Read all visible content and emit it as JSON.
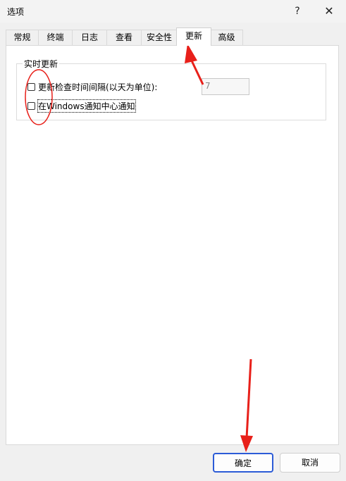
{
  "window": {
    "title": "选项",
    "help_glyph": "?",
    "close_glyph": "✕"
  },
  "tabs": [
    {
      "label": "常规"
    },
    {
      "label": "终端"
    },
    {
      "label": "日志"
    },
    {
      "label": "查看"
    },
    {
      "label": "安全性"
    },
    {
      "label": "更新",
      "active": true
    },
    {
      "label": "高级"
    }
  ],
  "group": {
    "title": "实时更新",
    "check_interval": {
      "label": "更新检查时间间隔(以天为单位):",
      "checked": false
    },
    "interval_value": "7",
    "notify": {
      "label": "在Windows通知中心通知",
      "checked": false
    }
  },
  "buttons": {
    "ok": "确定",
    "cancel": "取消"
  },
  "colors": {
    "annotation": "#e8201a",
    "primary_border": "#2b5bd7"
  }
}
